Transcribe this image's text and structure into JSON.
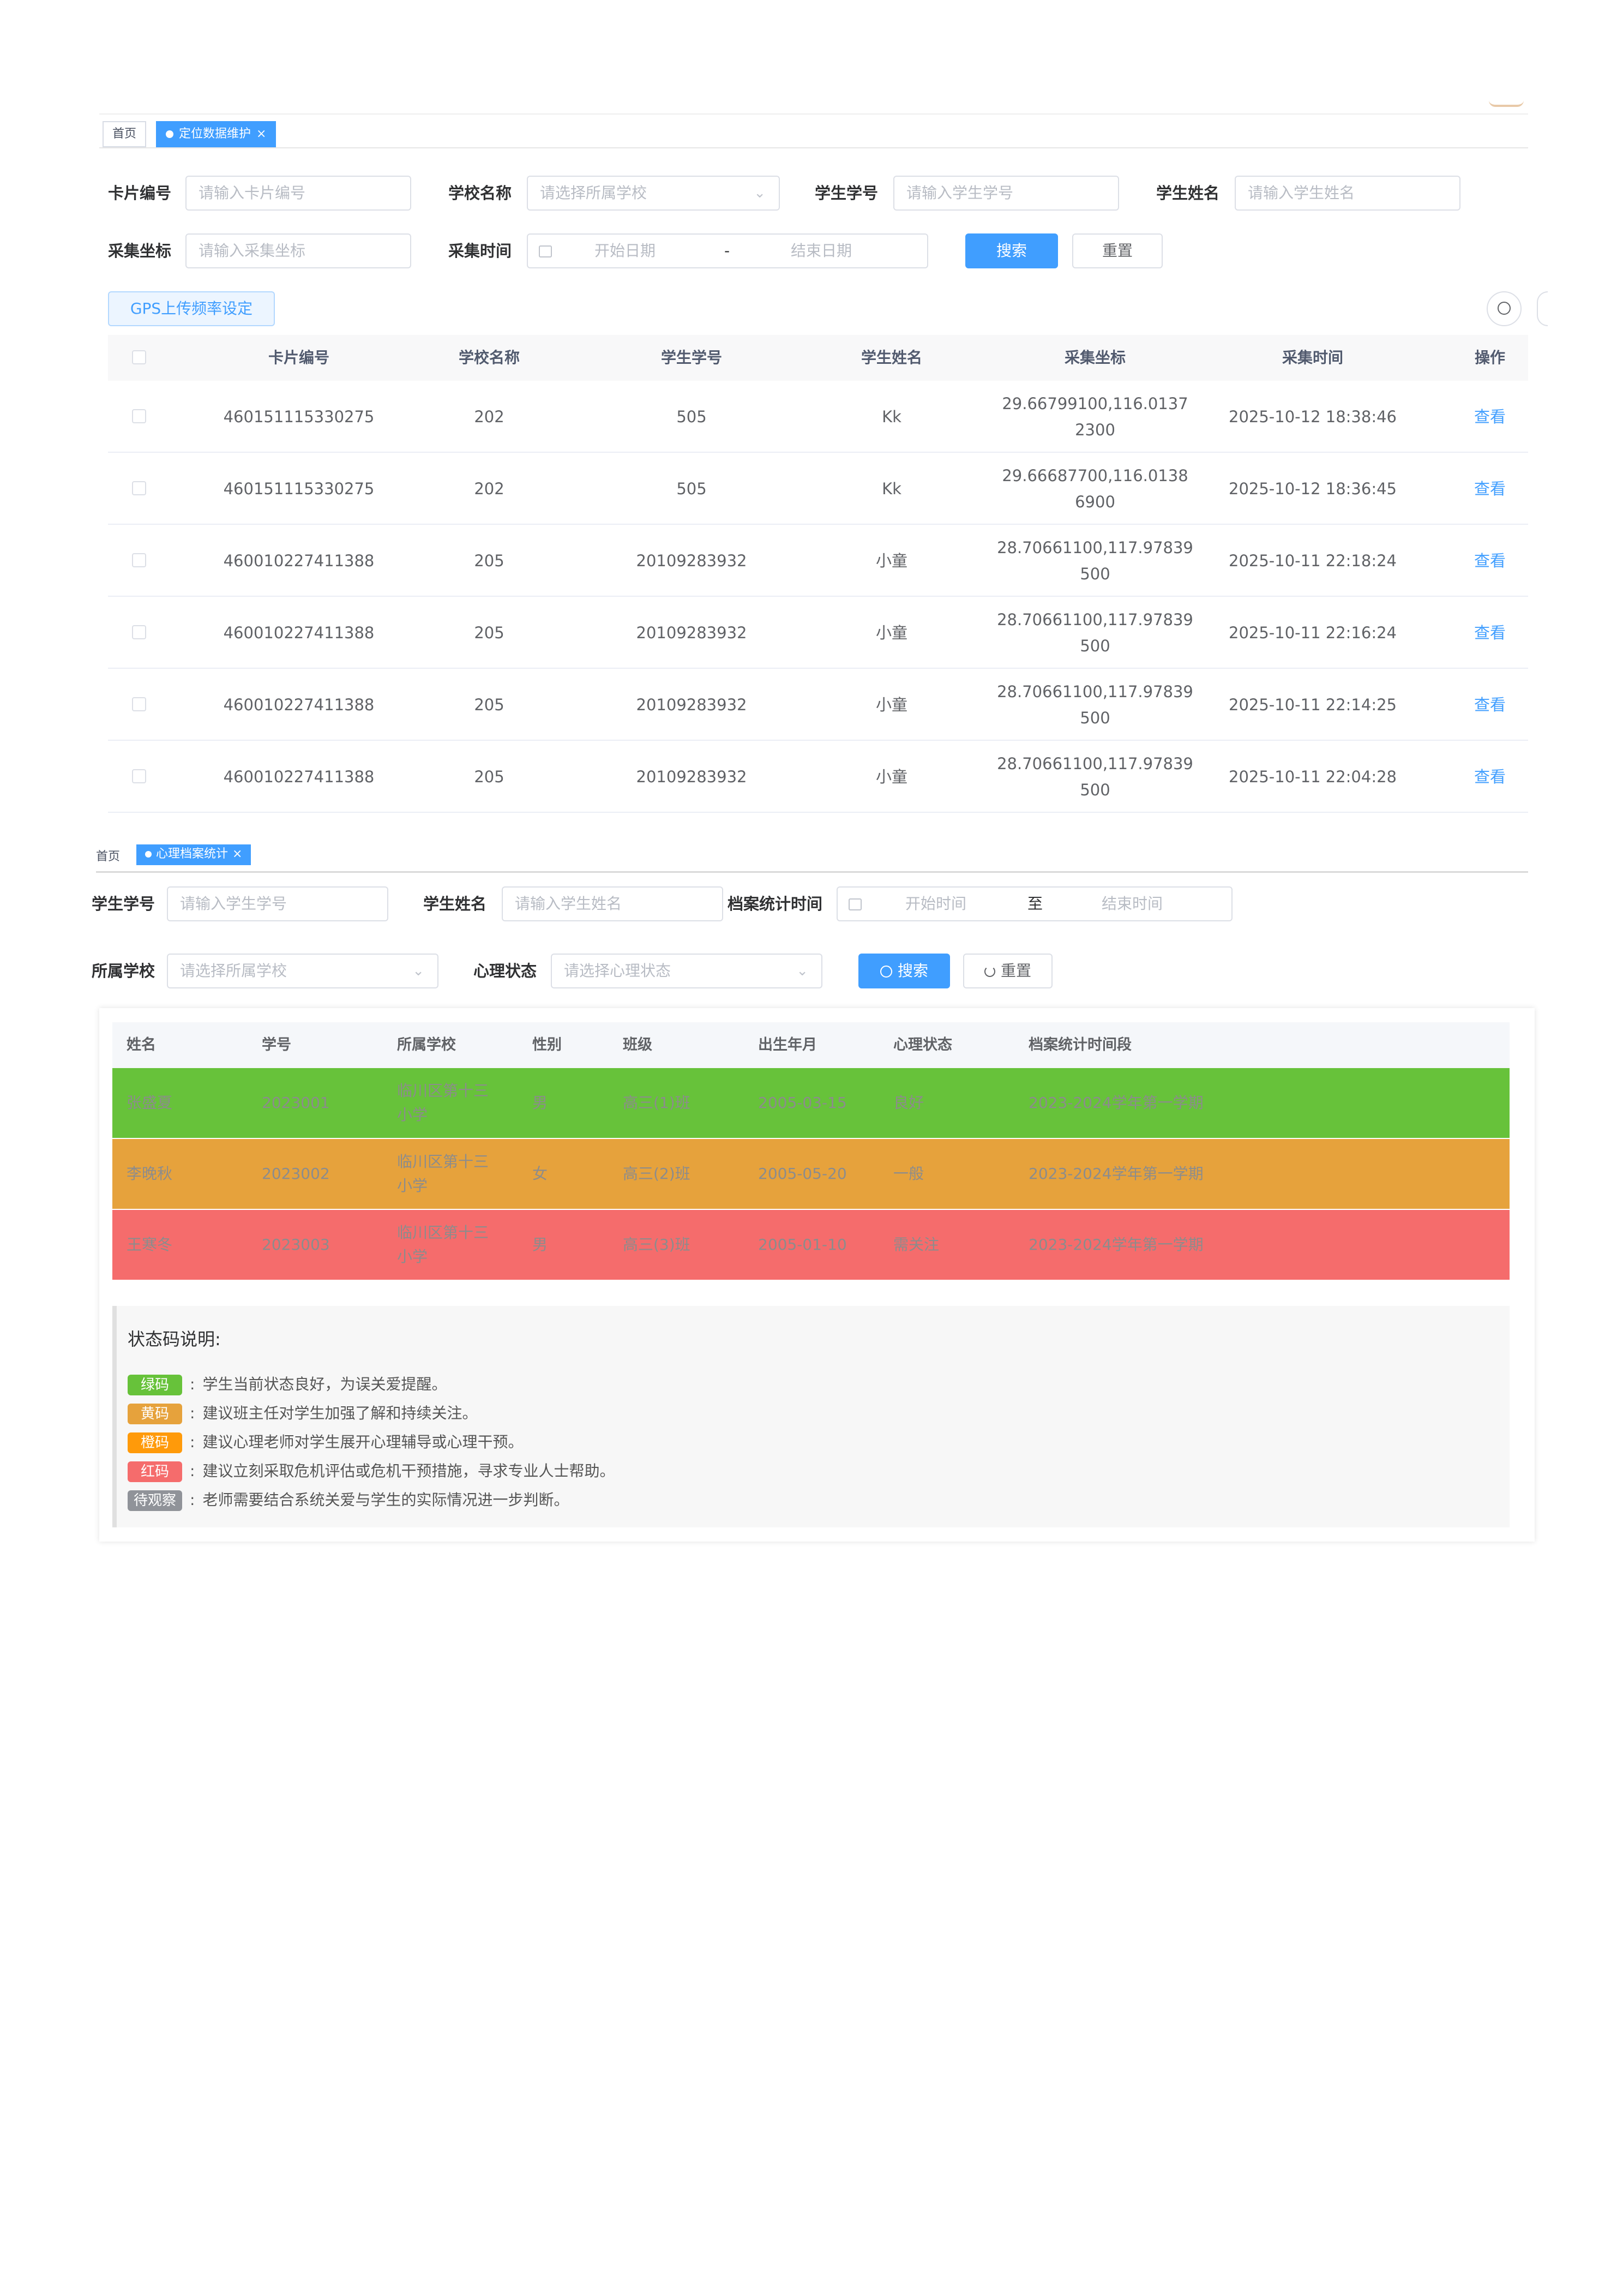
{
  "panel1": {
    "tabs": [
      {
        "label": "首页"
      },
      {
        "label": "定位数据维护",
        "close": "×"
      }
    ],
    "filters": {
      "card_no": {
        "label": "卡片编号",
        "placeholder": "请输入卡片编号"
      },
      "school": {
        "label": "学校名称",
        "placeholder": "请选择所属学校"
      },
      "student_no": {
        "label": "学生学号",
        "placeholder": "请输入学生学号"
      },
      "student_name": {
        "label": "学生姓名",
        "placeholder": "请输入学生姓名"
      },
      "coord": {
        "label": "采集坐标",
        "placeholder": "请输入采集坐标"
      },
      "time": {
        "label": "采集时间",
        "start": "开始日期",
        "sep": "-",
        "end": "结束日期"
      }
    },
    "search_label": "搜索",
    "reset_label": "重置",
    "gps_label": "GPS上传频率设定",
    "columns": [
      "卡片编号",
      "学校名称",
      "学生学号",
      "学生姓名",
      "采集坐标",
      "采集时间",
      "操作"
    ],
    "rows": [
      {
        "card": "460151115330275",
        "school": "202",
        "no": "505",
        "name": "Kk",
        "coord1": "29.66799100,116.0137",
        "coord2": "2300",
        "time": "2025-10-12 18:38:46",
        "action": "查看"
      },
      {
        "card": "460151115330275",
        "school": "202",
        "no": "505",
        "name": "Kk",
        "coord1": "29.66687700,116.0138",
        "coord2": "6900",
        "time": "2025-10-12 18:36:45",
        "action": "查看"
      },
      {
        "card": "460010227411388",
        "school": "205",
        "no": "20109283932",
        "name": "小童",
        "coord1": "28.70661100,117.97839",
        "coord2": "500",
        "time": "2025-10-11 22:18:24",
        "action": "查看"
      },
      {
        "card": "460010227411388",
        "school": "205",
        "no": "20109283932",
        "name": "小童",
        "coord1": "28.70661100,117.97839",
        "coord2": "500",
        "time": "2025-10-11 22:16:24",
        "action": "查看"
      },
      {
        "card": "460010227411388",
        "school": "205",
        "no": "20109283932",
        "name": "小童",
        "coord1": "28.70661100,117.97839",
        "coord2": "500",
        "time": "2025-10-11 22:14:25",
        "action": "查看"
      },
      {
        "card": "460010227411388",
        "school": "205",
        "no": "20109283932",
        "name": "小童",
        "coord1": "28.70661100,117.97839",
        "coord2": "500",
        "time": "2025-10-11 22:04:28",
        "action": "查看"
      }
    ]
  },
  "panel2": {
    "tabs": [
      {
        "label": "首页"
      },
      {
        "label": "心理档案统计",
        "close": "×"
      }
    ],
    "filters": {
      "student_no": {
        "label": "学生学号",
        "placeholder": "请输入学生学号"
      },
      "student_name": {
        "label": "学生姓名",
        "placeholder": "请输入学生姓名"
      },
      "period": {
        "label": "档案统计时间",
        "start": "开始时间",
        "sep": "至",
        "end": "结束时间"
      },
      "school": {
        "label": "所属学校",
        "placeholder": "请选择所属学校"
      },
      "status": {
        "label": "心理状态",
        "placeholder": "请选择心理状态"
      }
    },
    "search_label": "搜索",
    "reset_label": "重置",
    "columns": [
      "姓名",
      "学号",
      "所属学校",
      "性别",
      "班级",
      "出生年月",
      "心理状态",
      "档案统计时间段"
    ],
    "rows": [
      {
        "name": "张盛夏",
        "no": "2023001",
        "school1": "临川区第十三",
        "school2": "小学",
        "gender": "男",
        "class": "高三(1)班",
        "birth": "2005-03-15",
        "status": "良好",
        "period": "2023-2024学年第一学期",
        "bg": "#67c23a"
      },
      {
        "name": "李晚秋",
        "no": "2023002",
        "school1": "临川区第十三",
        "school2": "小学",
        "gender": "女",
        "class": "高三(2)班",
        "birth": "2005-05-20",
        "status": "一般",
        "period": "2023-2024学年第一学期",
        "bg": "#e6a23c"
      },
      {
        "name": "王寒冬",
        "no": "2023003",
        "school1": "临川区第十三",
        "school2": "小学",
        "gender": "男",
        "class": "高三(3)班",
        "birth": "2005-01-10",
        "status": "需关注",
        "period": "2023-2024学年第一学期",
        "bg": "#f56c6c"
      }
    ],
    "legend": {
      "title": "状态码说明:",
      "items": [
        {
          "badge": "绿码",
          "color": "#67c23a",
          "sep": ":",
          "text": "学生当前状态良好，为误关爱提醒。"
        },
        {
          "badge": "黄码",
          "color": "#e6a23c",
          "sep": ":",
          "text": "建议班主任对学生加强了解和持续关注。"
        },
        {
          "badge": "橙码",
          "color": "#ff9a0a",
          "sep": ":",
          "text": "建议心理老师对学生展开心理辅导或心理干预。"
        },
        {
          "badge": "红码",
          "color": "#f56c6c",
          "sep": ":",
          "text": "建议立刻采取危机评估或危机干预措施，寻求专业人士帮助。"
        },
        {
          "badge": "待观察",
          "color": "#909399",
          "sep": ":",
          "text": "老师需要结合系统关爱与学生的实际情况进一步判断。"
        }
      ]
    }
  }
}
